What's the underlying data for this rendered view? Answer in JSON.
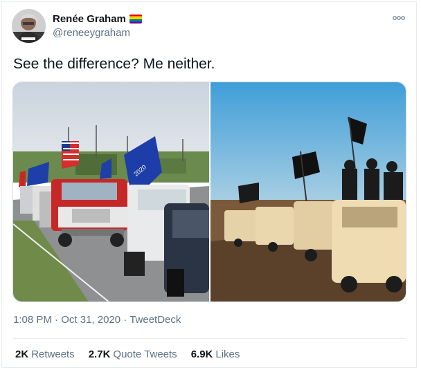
{
  "author": {
    "display_name": "Renée Graham",
    "handle": "@reneeygraham",
    "flag_emoji": "rainbow-flag-icon"
  },
  "tweet": {
    "text": "See the difference? Me neither.",
    "time": "1:08 PM",
    "separator": "·",
    "date": "Oct 31, 2020",
    "source": "TweetDeck"
  },
  "stats": {
    "retweets_count": "2K",
    "retweets_label": "Retweets",
    "quotes_count": "2.7K",
    "quotes_label": "Quote Tweets",
    "likes_count": "6.9K",
    "likes_label": "Likes"
  },
  "colors": {
    "muted": "#5b7083",
    "border": "#e6ecf0",
    "text": "#0f1419"
  }
}
